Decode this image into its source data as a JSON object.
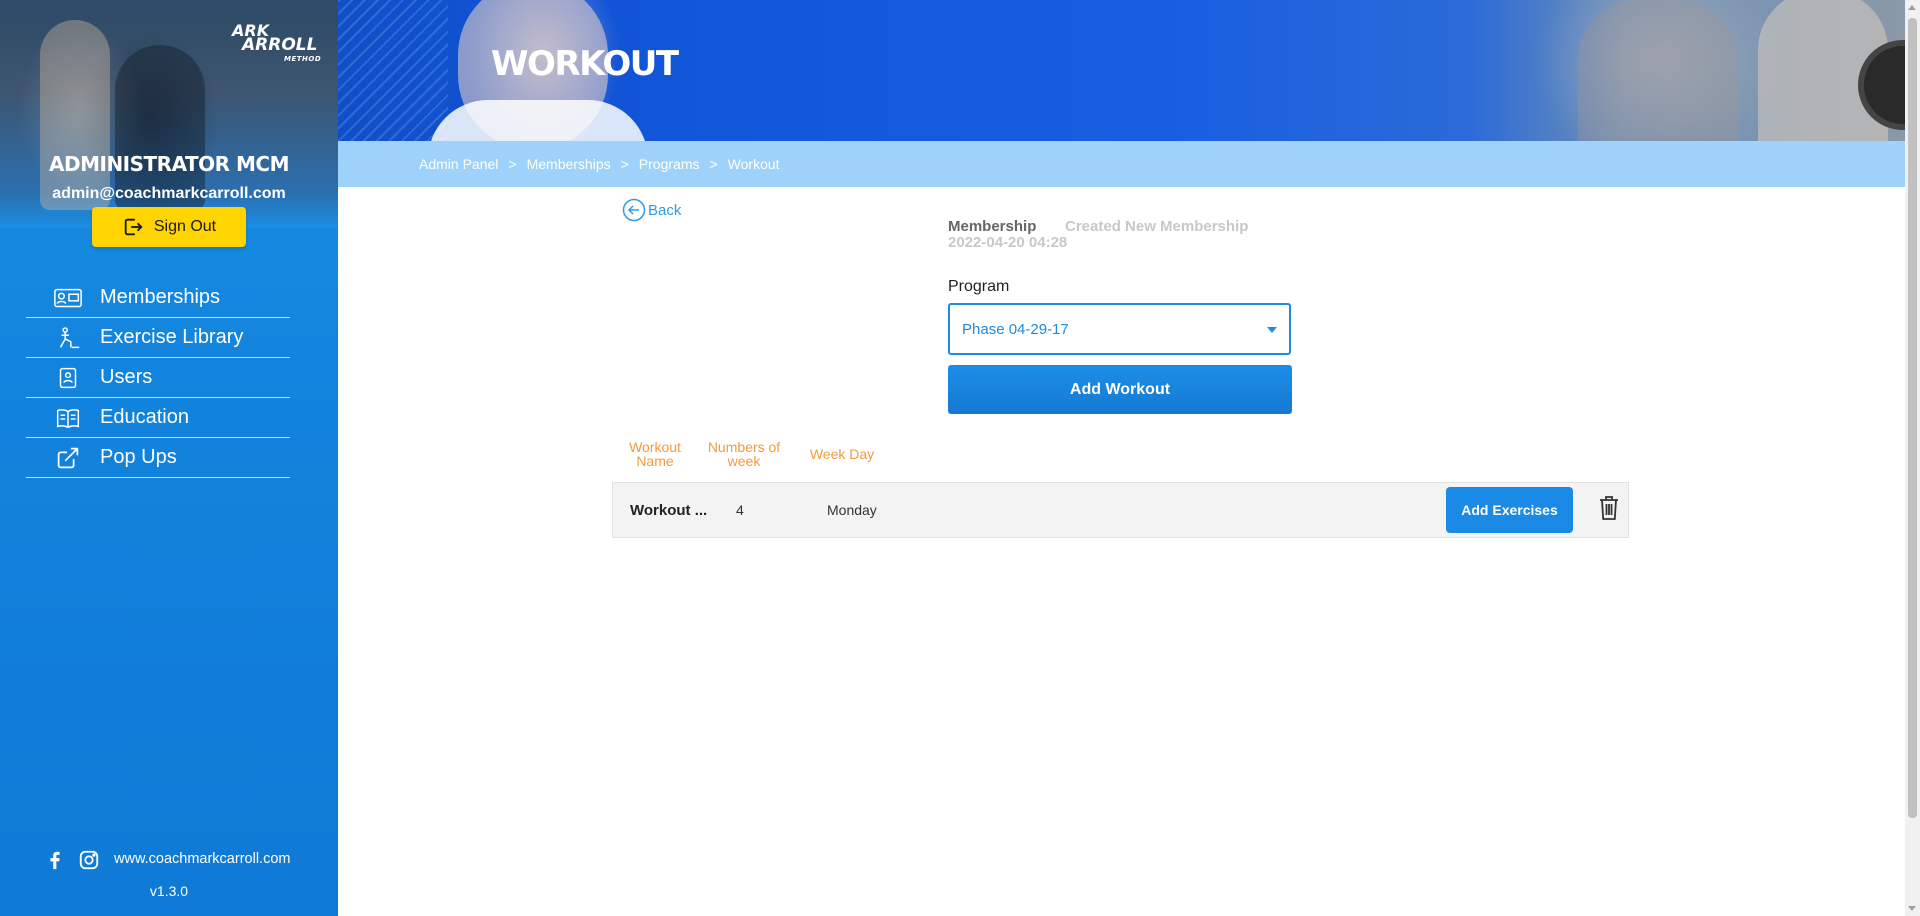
{
  "sidebar": {
    "logo": {
      "line1": "ARK",
      "line2": "ARROLL",
      "line3": "METHOD"
    },
    "admin_name": "ADMINISTRATOR MCM",
    "admin_email": "admin@coachmarkcarroll.com",
    "signout_label": "Sign Out",
    "nav": [
      {
        "label": "Memberships",
        "icon": "membership-card-icon"
      },
      {
        "label": "Exercise Library",
        "icon": "exercise-icon"
      },
      {
        "label": "Users",
        "icon": "users-icon"
      },
      {
        "label": "Education",
        "icon": "book-icon"
      },
      {
        "label": "Pop Ups",
        "icon": "external-link-icon"
      }
    ],
    "website": "www.coachmarkcarroll.com",
    "version": "v1.3.0"
  },
  "banner": {
    "title": "WORKOUT"
  },
  "breadcrumb": [
    "Admin Panel",
    ">",
    "Memberships",
    ">",
    "Programs",
    ">",
    "Workout"
  ],
  "main": {
    "back_label": "Back",
    "membership_label": "Membership",
    "membership_value": "Created New Membership",
    "membership_date": "2022-04-20 04:28",
    "program_label": "Program",
    "program_selected": "Phase 04-29-17",
    "add_workout_label": "Add Workout",
    "table": {
      "headers": [
        "Workout Name",
        "Numbers of week",
        "Week Day"
      ],
      "rows": [
        {
          "name": "Workout ...",
          "weeks": "4",
          "day": "Monday",
          "action": "Add Exercises"
        }
      ]
    }
  },
  "colors": {
    "sidebar": "#1283dc",
    "accent": "#1e8ae0",
    "signout": "#ffd400",
    "breadcrumb_bar": "#9fd2fb",
    "table_header": "#f59a3c"
  }
}
